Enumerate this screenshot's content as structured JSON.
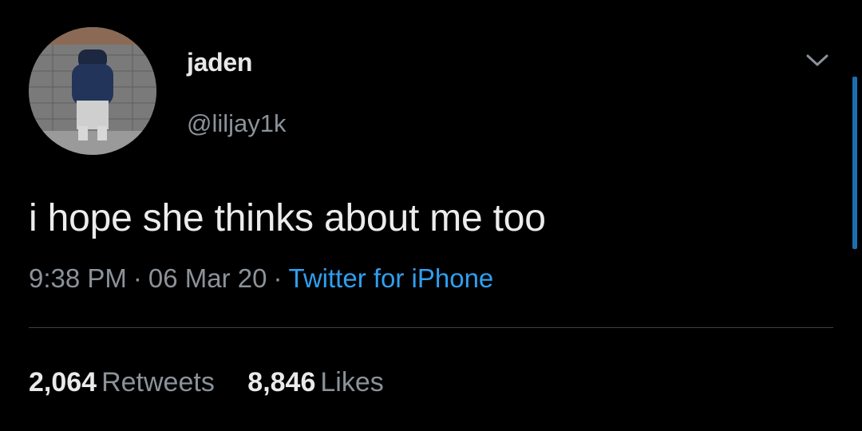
{
  "user": {
    "display_name": "jaden",
    "handle": "@liljay1k"
  },
  "tweet": {
    "text": "i hope she thinks about me too",
    "time": "9:38 PM",
    "date": "06 Mar 20",
    "separator": "·",
    "source": "Twitter for iPhone"
  },
  "stats": {
    "retweets_count": "2,064",
    "retweets_label": "Retweets",
    "likes_count": "8,846",
    "likes_label": "Likes"
  },
  "icons": {
    "menu": "chevron-down-icon"
  },
  "colors": {
    "background": "#000000",
    "link": "#2f9ff0",
    "muted": "#8b9299",
    "scrollbar": "#1b6fb3"
  }
}
